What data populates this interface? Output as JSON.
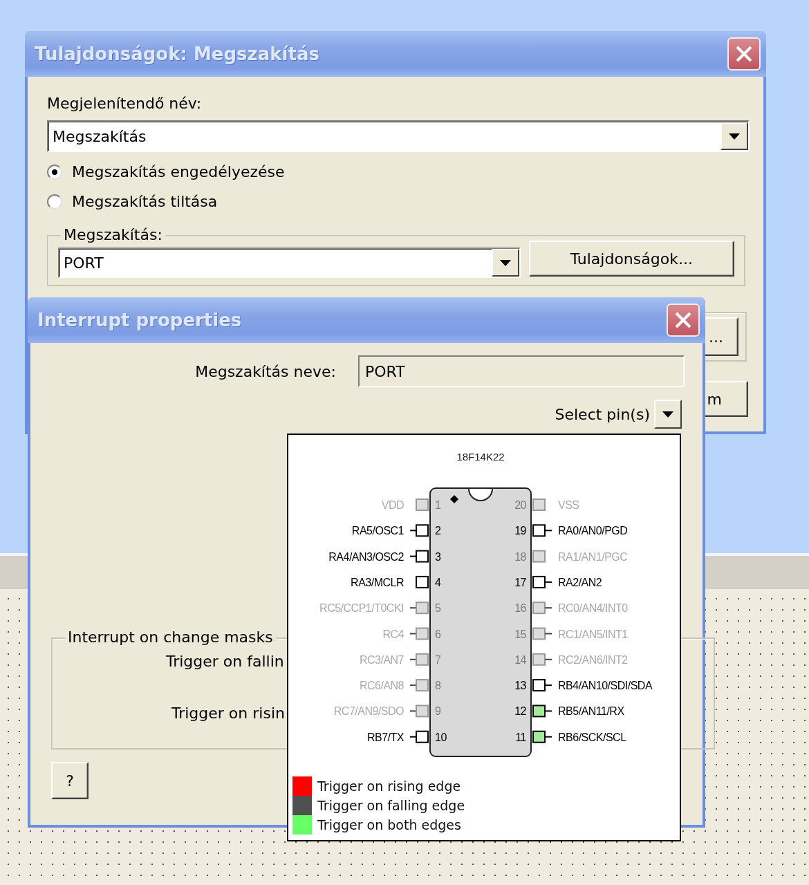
{
  "properties_dialog": {
    "title": "Tulajdonságok: Megszakítás",
    "display_name_label": "Megjelenítendő név:",
    "display_name": "Megszakítás",
    "radios": [
      {
        "label": "Megszakítás engedélyezése",
        "selected": true
      },
      {
        "label": "Megszakítás tiltása",
        "selected": false
      }
    ],
    "interrupt_group": {
      "label": "Megszakítás:",
      "value": "PORT",
      "button": "Tulajdonságok..."
    },
    "partial_buttons": [
      "...",
      "m"
    ]
  },
  "interrupt_dialog": {
    "title": "Interrupt properties",
    "name_label": "Megszakítás neve:",
    "name_value": "PORT",
    "select_pins_label": "Select pin(s)",
    "masks_group": {
      "label": "Interrupt on change masks",
      "rows": [
        "Trigger on fallin",
        "Trigger on risin"
      ]
    },
    "help_button": "?"
  },
  "pin_popup": {
    "chip": "18F14K22",
    "left_pins": [
      {
        "number": "1",
        "name": "VDD",
        "enabled": false,
        "lead": false,
        "both_edges": false
      },
      {
        "number": "2",
        "name": "RA5/OSC1",
        "enabled": true,
        "lead": true,
        "both_edges": false
      },
      {
        "number": "3",
        "name": "RA4/AN3/OSC2",
        "enabled": true,
        "lead": true,
        "both_edges": false
      },
      {
        "number": "4",
        "name": "RA3/MCLR",
        "enabled": true,
        "lead": false,
        "both_edges": false
      },
      {
        "number": "5",
        "name": "RC5/CCP1/T0CKI",
        "enabled": false,
        "lead": true,
        "both_edges": false
      },
      {
        "number": "6",
        "name": "RC4",
        "enabled": false,
        "lead": true,
        "both_edges": false
      },
      {
        "number": "7",
        "name": "RC3/AN7",
        "enabled": false,
        "lead": true,
        "both_edges": false
      },
      {
        "number": "8",
        "name": "RC6/AN8",
        "enabled": false,
        "lead": true,
        "both_edges": false
      },
      {
        "number": "9",
        "name": "RC7/AN9/SDO",
        "enabled": false,
        "lead": true,
        "both_edges": false
      },
      {
        "number": "10",
        "name": "RB7/TX",
        "enabled": true,
        "lead": true,
        "both_edges": false
      }
    ],
    "right_pins": [
      {
        "number": "20",
        "name": "VSS",
        "enabled": false,
        "lead": false,
        "both_edges": false
      },
      {
        "number": "19",
        "name": "RA0/AN0/PGD",
        "enabled": true,
        "lead": true,
        "both_edges": false
      },
      {
        "number": "18",
        "name": "RA1/AN1/PGC",
        "enabled": false,
        "lead": false,
        "both_edges": false
      },
      {
        "number": "17",
        "name": "RA2/AN2",
        "enabled": true,
        "lead": true,
        "both_edges": false
      },
      {
        "number": "16",
        "name": "RC0/AN4/INT0",
        "enabled": false,
        "lead": true,
        "both_edges": false
      },
      {
        "number": "15",
        "name": "RC1/AN5/INT1",
        "enabled": false,
        "lead": true,
        "both_edges": false
      },
      {
        "number": "14",
        "name": "RC2/AN6/INT2",
        "enabled": false,
        "lead": true,
        "both_edges": false
      },
      {
        "number": "13",
        "name": "RB4/AN10/SDI/SDA",
        "enabled": true,
        "lead": true,
        "both_edges": false
      },
      {
        "number": "12",
        "name": "RB5/AN11/RX",
        "enabled": true,
        "lead": true,
        "both_edges": true
      },
      {
        "number": "11",
        "name": "RB6/SCK/SCL",
        "enabled": true,
        "lead": true,
        "both_edges": true
      }
    ],
    "legend": [
      {
        "label": "Trigger on rising edge",
        "color": "#ff0000"
      },
      {
        "label": "Trigger on falling edge",
        "color": "#505050"
      },
      {
        "label": "Trigger on both edges",
        "color": "#66ff66"
      }
    ]
  }
}
